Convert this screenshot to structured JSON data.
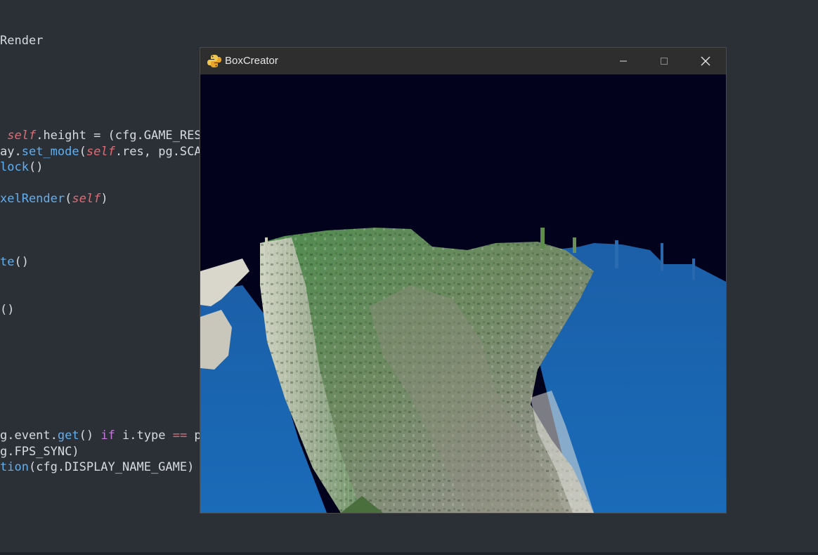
{
  "editor": {
    "lines": [
      {
        "id": "l1",
        "parts": [
          {
            "t": "Render",
            "c": ""
          }
        ]
      },
      {
        "id": "l2",
        "parts": [
          {
            "t": " ",
            "c": ""
          },
          {
            "t": "self",
            "c": "kw-self"
          },
          {
            "t": ".height = (cfg.GAME_RES",
            "c": ""
          }
        ]
      },
      {
        "id": "l3",
        "parts": [
          {
            "t": "ay.",
            "c": ""
          },
          {
            "t": "set_mode",
            "c": "fn"
          },
          {
            "t": "(",
            "c": ""
          },
          {
            "t": "self",
            "c": "kw-self"
          },
          {
            "t": ".res, pg.SCA",
            "c": ""
          }
        ]
      },
      {
        "id": "l4",
        "parts": [
          {
            "t": "lock",
            "c": "fn"
          },
          {
            "t": "()",
            "c": ""
          }
        ]
      },
      {
        "id": "l5",
        "parts": [
          {
            "t": "xelRender",
            "c": "fn"
          },
          {
            "t": "(",
            "c": ""
          },
          {
            "t": "self",
            "c": "kw-self"
          },
          {
            "t": ")",
            "c": ""
          }
        ]
      },
      {
        "id": "l6",
        "parts": [
          {
            "t": "te",
            "c": "fn"
          },
          {
            "t": "()",
            "c": ""
          }
        ]
      },
      {
        "id": "l7",
        "parts": [
          {
            "t": "()",
            "c": ""
          }
        ]
      },
      {
        "id": "l8",
        "parts": [
          {
            "t": "g.event.",
            "c": ""
          },
          {
            "t": "get",
            "c": "fn"
          },
          {
            "t": "() ",
            "c": ""
          },
          {
            "t": "if",
            "c": "kw"
          },
          {
            "t": " i.type ",
            "c": ""
          },
          {
            "t": "==",
            "c": "op"
          },
          {
            "t": " p",
            "c": ""
          }
        ]
      },
      {
        "id": "l9",
        "parts": [
          {
            "t": "g.FPS_SYNC)",
            "c": ""
          }
        ]
      },
      {
        "id": "l10",
        "parts": [
          {
            "t": "tion",
            "c": "fn"
          },
          {
            "t": "(cfg.DISPLAY_NAME_GAME)",
            "c": ""
          }
        ]
      }
    ]
  },
  "window": {
    "title": "BoxCreator",
    "minimize_symbol": "—",
    "maximize_symbol": "☐",
    "close_symbol": "✕"
  }
}
